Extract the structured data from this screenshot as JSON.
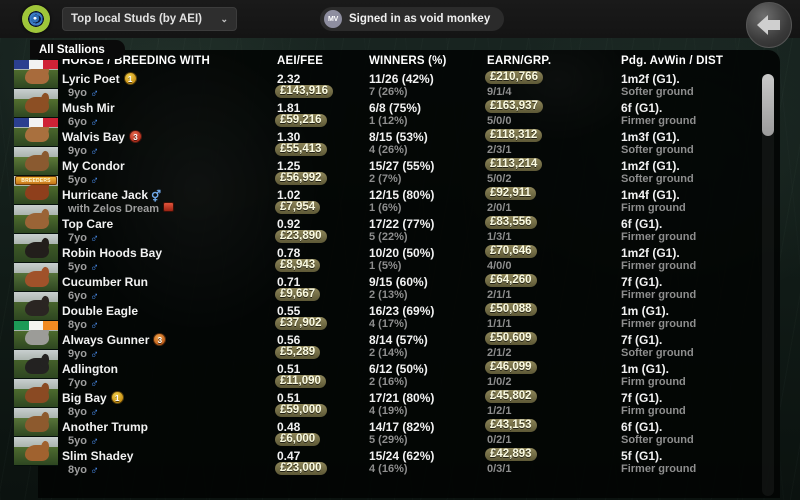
{
  "topbar": {
    "logo": "eye-logo",
    "dropdown_value": "Top local Studs (by AEI)",
    "dropdown_chevron": "⌄",
    "account_initials": "MV",
    "signed_in_text": "Signed in as void monkey",
    "back_label": "Back"
  },
  "tab": {
    "label": "All Stallions"
  },
  "columns": {
    "horse": "HORSE / BREEDING WITH",
    "aei": "AEI/FEE",
    "winners": "WINNERS (%)",
    "earn": "EARN/GRP.",
    "dist": "Pdg. AvWin / DIST"
  },
  "colors": {
    "value_highlight_bg": "#5d5836",
    "value_highlight_text": "#fbfbe2",
    "primary_text": "#f2f2f2",
    "secondary_text": "#8e8e8e",
    "panel_bg": "#020403",
    "page_bg": "#101a16",
    "badge_gold": "#c99014",
    "badge_red": "#b5301d",
    "badge_orange": "#c2601b",
    "male_symbol": "#4b8ff0"
  },
  "rows": [
    {
      "name": "Lyric Poet",
      "badge": "1",
      "badge_color": "gold",
      "sub": "9yo",
      "sex": "♂",
      "aei": "2.32",
      "fee": "£143,916",
      "winners": "11/26 (42%)",
      "winners_sub": "7 (26%)",
      "earn": "£210,766",
      "grp": "9/1/4",
      "dist": "1m2f  (G1).",
      "ground": "Softer ground",
      "flag": "fr",
      "coat": "#a86b3c",
      "field": "#4e6b2e"
    },
    {
      "name": "Mush Mir",
      "badge": null,
      "badge_color": null,
      "sub": "6yo",
      "sex": "♂",
      "aei": "1.81",
      "fee": "£59,216",
      "winners": "6/8 (75%)",
      "winners_sub": "1 (12%)",
      "earn": "£163,937",
      "grp": "5/0/0",
      "dist": "6f  (G1).",
      "ground": "Firmer ground",
      "flag": null,
      "coat": "#8c4f24",
      "field": "#53702f"
    },
    {
      "name": "Walvis Bay",
      "badge": "3",
      "badge_color": "red",
      "sub": "9yo",
      "sex": "♂",
      "aei": "1.30",
      "fee": "£55,413",
      "winners": "8/15 (53%)",
      "winners_sub": "4 (26%)",
      "earn": "£118,312",
      "grp": "2/3/1",
      "dist": "1m3f  (G1).",
      "ground": "Softer ground",
      "flag": "fr",
      "coat": "#a9703e",
      "field": "#4b672c"
    },
    {
      "name": "My Condor",
      "badge": null,
      "badge_color": null,
      "sub": "5yo",
      "sex": "♂",
      "aei": "1.25",
      "fee": "£56,992",
      "winners": "15/27 (55%)",
      "winners_sub": "2 (7%)",
      "earn": "£113,214",
      "grp": "5/0/2",
      "dist": "1m2f  (G1).",
      "ground": "Softer ground",
      "flag": null,
      "coat": "#8a5a30",
      "field": "#5d7a38"
    },
    {
      "name": "Hurricane Jack",
      "badge": null,
      "badge_color": null,
      "sub": "with Zelos Dream",
      "sex": null,
      "sub_badge": "square-red",
      "name_sex": "⚥",
      "aei": "1.02",
      "fee": "£7,954",
      "winners": "12/15 (80%)",
      "winners_sub": "1 (6%)",
      "earn": "£92,911",
      "grp": "2/0/1",
      "dist": "1m4f  (G1).",
      "ground": "Firm ground",
      "flag": "breeders",
      "coat": "#8e3f1c",
      "field": "#4e6a2c"
    },
    {
      "name": "Top Care",
      "badge": null,
      "badge_color": null,
      "sub": "7yo",
      "sex": "♂",
      "aei": "0.92",
      "fee": "£23,890",
      "winners": "17/22 (77%)",
      "winners_sub": "5 (22%)",
      "earn": "£83,556",
      "grp": "1/3/1",
      "dist": "6f  (G1).",
      "ground": "Firmer ground",
      "flag": null,
      "coat": "#9a6436",
      "field": "#4f6d2e"
    },
    {
      "name": "Robin Hoods Bay",
      "badge": null,
      "badge_color": null,
      "sub": "5yo",
      "sex": "♂",
      "aei": "0.78",
      "fee": "£8,943",
      "winners": "10/20 (50%)",
      "winners_sub": "1 (5%)",
      "earn": "£70,646",
      "grp": "4/0/0",
      "dist": "1m2f  (G1).",
      "ground": "Firmer ground",
      "flag": null,
      "coat": "#221e1b",
      "field": "#3f5a27"
    },
    {
      "name": "Cucumber Run",
      "badge": null,
      "badge_color": null,
      "sub": "6yo",
      "sex": "♂",
      "aei": "0.71",
      "fee": "£9,667",
      "winners": "9/15 (60%)",
      "winners_sub": "2 (13%)",
      "earn": "£64,260",
      "grp": "2/1/1",
      "dist": "7f  (G1).",
      "ground": "Firmer ground",
      "flag": null,
      "coat": "#a0522a",
      "field": "#55713a"
    },
    {
      "name": "Double Eagle",
      "badge": null,
      "badge_color": null,
      "sub": "8yo",
      "sex": "♂",
      "aei": "0.55",
      "fee": "£37,902",
      "winners": "16/23 (69%)",
      "winners_sub": "4 (17%)",
      "earn": "£50,088",
      "grp": "1/1/1",
      "dist": "1m  (G1).",
      "ground": "Firmer ground",
      "flag": null,
      "coat": "#2a2522",
      "field": "#47632c"
    },
    {
      "name": "Always Gunner",
      "badge": "3",
      "badge_color": "orange",
      "sub": "9yo",
      "sex": "♂",
      "aei": "0.56",
      "fee": "£5,289",
      "winners": "8/14 (57%)",
      "winners_sub": "2 (14%)",
      "earn": "£50,609",
      "grp": "2/1/2",
      "dist": "7f  (G1).",
      "ground": "Softer ground",
      "flag": "ie",
      "coat": "#9c9c98",
      "field": "#4c6a2d"
    },
    {
      "name": "Adlington",
      "badge": null,
      "badge_color": null,
      "sub": "7yo",
      "sex": "♂",
      "aei": "0.51",
      "fee": "£11,090",
      "winners": "6/12 (50%)",
      "winners_sub": "2 (16%)",
      "earn": "£46,099",
      "grp": "1/0/2",
      "dist": "1m  (G1).",
      "ground": "Firm ground",
      "flag": null,
      "coat": "#232221",
      "field": "#44602a"
    },
    {
      "name": "Big Bay",
      "badge": "1",
      "badge_color": "gold",
      "sub": "8yo",
      "sex": "♂",
      "aei": "0.51",
      "fee": "£59,000",
      "winners": "17/21 (80%)",
      "winners_sub": "4 (19%)",
      "earn": "£45,802",
      "grp": "1/2/1",
      "dist": "7f  (G1).",
      "ground": "Firm ground",
      "flag": null,
      "coat": "#8a4a23",
      "field": "#4d6b2e"
    },
    {
      "name": "Another Trump",
      "badge": null,
      "badge_color": null,
      "sub": "5yo",
      "sex": "♂",
      "aei": "0.48",
      "fee": "£6,000",
      "winners": "14/17 (82%)",
      "winners_sub": "5 (29%)",
      "earn": "£43,153",
      "grp": "0/2/1",
      "dist": "6f  (G1).",
      "ground": "Softer ground",
      "flag": null,
      "coat": "#8d5a2e",
      "field": "#587439"
    },
    {
      "name": "Slim Shadey",
      "badge": null,
      "badge_color": null,
      "sub": "8yo",
      "sex": "♂",
      "aei": "0.47",
      "fee": "£23,000",
      "winners": "15/24 (62%)",
      "winners_sub": "4 (16%)",
      "earn": "£42,893",
      "grp": "0/3/1",
      "dist": "5f  (G1).",
      "ground": "Firmer ground",
      "flag": null,
      "coat": "#a0622f",
      "field": "#4f6c30"
    }
  ],
  "scrollbar": {
    "position": "top"
  }
}
